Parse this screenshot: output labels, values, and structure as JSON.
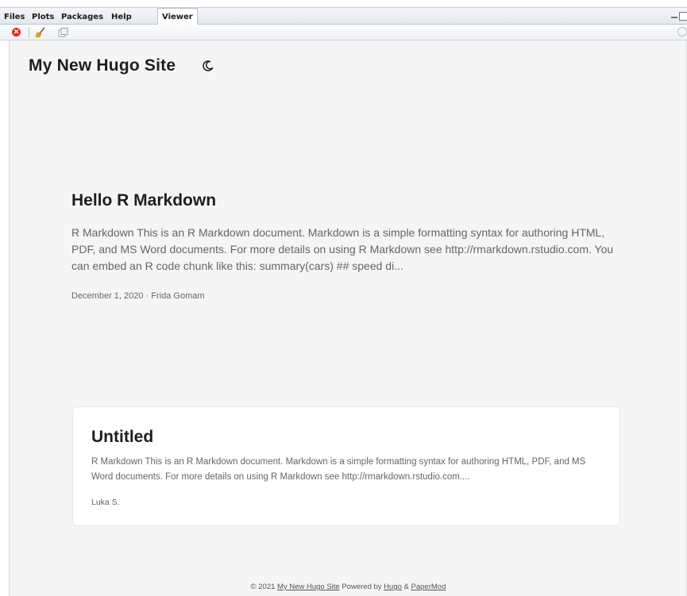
{
  "pane_tabs": [
    "Files",
    "Plots",
    "Packages",
    "Help",
    "Viewer"
  ],
  "active_tab": "Viewer",
  "toolbar": {
    "icons": [
      "stop-icon",
      "broom-icon",
      "popout-icon",
      "refresh-icon"
    ]
  },
  "site": {
    "title": "My New Hugo Site",
    "theme_toggle_icon": "moon-icon"
  },
  "posts": [
    {
      "title": "Hello R Markdown",
      "summary": "R Markdown This is an R Markdown document. Markdown is a simple formatting syntax for authoring HTML, PDF, and MS Word documents. For more details on using R Markdown see http://rmarkdown.rstudio.com. You can embed an R code chunk like this: summary(cars) ## speed di...",
      "meta": "December 1, 2020 · Frida Gomam"
    },
    {
      "title": "Untitled",
      "summary": "R Markdown This is an R Markdown document. Markdown is a simple formatting syntax for authoring HTML, PDF, and MS Word documents. For more details on using R Markdown see http://rmarkdown.rstudio.com....",
      "meta": "Luka S."
    }
  ],
  "footer": {
    "copyright": "© 2021",
    "site_link": "My New Hugo Site",
    "powered_by": "Powered by",
    "hugo_link": "Hugo",
    "amp": "&",
    "papermod_link": "PaperMod"
  },
  "colors": {
    "page_bg": "#f5f5f5",
    "card_bg": "#ffffff",
    "title_text": "#1e1e1e",
    "body_text": "#666666",
    "stop_red": "#d62d20"
  }
}
